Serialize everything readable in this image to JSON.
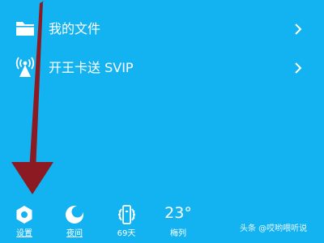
{
  "menu": {
    "items": [
      {
        "label": "我的文件",
        "icon": "folder-icon"
      },
      {
        "label": "开王卡送 SVIP",
        "icon": "broadcast-antenna-icon"
      }
    ]
  },
  "bottom_bar": {
    "settings": {
      "label": "设置",
      "icon": "gear-icon"
    },
    "night_mode": {
      "label": "夜间",
      "icon": "moon-icon"
    },
    "days": {
      "label": "69天",
      "icon": "badge-icon"
    },
    "weather": {
      "temperature": "23°",
      "city": "梅列"
    }
  },
  "annotation": {
    "arrow_color": "#8b1a22"
  },
  "watermark": "头条 @哎哟喂听说",
  "colors": {
    "background": "#13b3f1",
    "text": "#ffffff"
  }
}
